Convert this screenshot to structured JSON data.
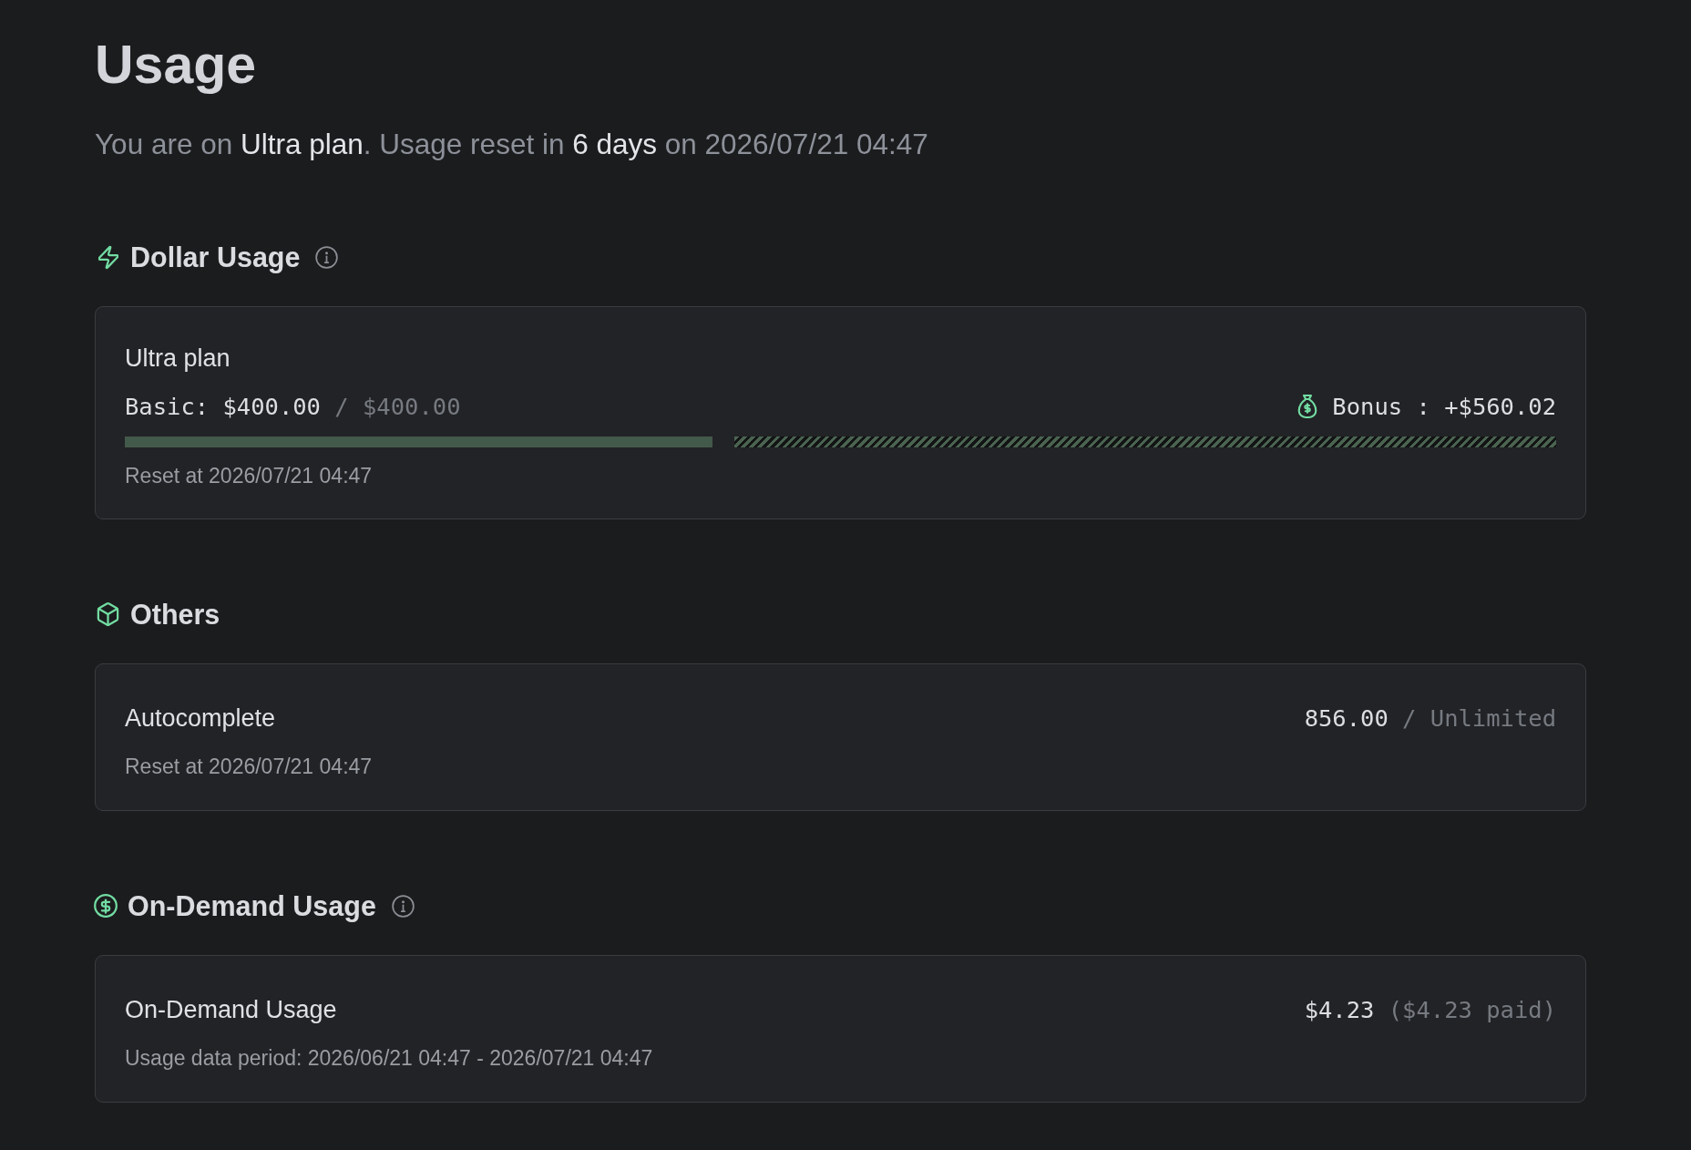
{
  "page": {
    "title": "Usage",
    "summary": "You are on **Ultra plan**. Usage reset in **6 days** on 2026/07/21 04:47"
  },
  "sections": [
    {
      "kind": "dollar_usage",
      "heading": "Dollar Usage",
      "info": true,
      "card": {
        "title": "Ultra plan",
        "basic": {
          "label": "Basic:",
          "value": "$400.00",
          "limit": "/ $400.00"
        },
        "bonus": "Bonus : +$560.02",
        "bar": {
          "level": 0.417
        },
        "note": "Reset at 2026/07/21 04:47"
      }
    },
    {
      "kind": "others",
      "heading": "Others",
      "info": false,
      "card": {
        "title": "Autocomplete",
        "value": "856.00",
        "limit": "/ Unlimited",
        "note": "Reset at 2026/07/21 04:47"
      }
    },
    {
      "kind": "on_demand",
      "heading": "On-Demand Usage",
      "info": true,
      "card": {
        "title": "On-Demand Usage",
        "value": "$4.23",
        "limit": "($4.23 paid)",
        "note": "Usage data period: 2026/06/21 04:47 - 2026/07/21 04:47"
      }
    }
  ]
}
